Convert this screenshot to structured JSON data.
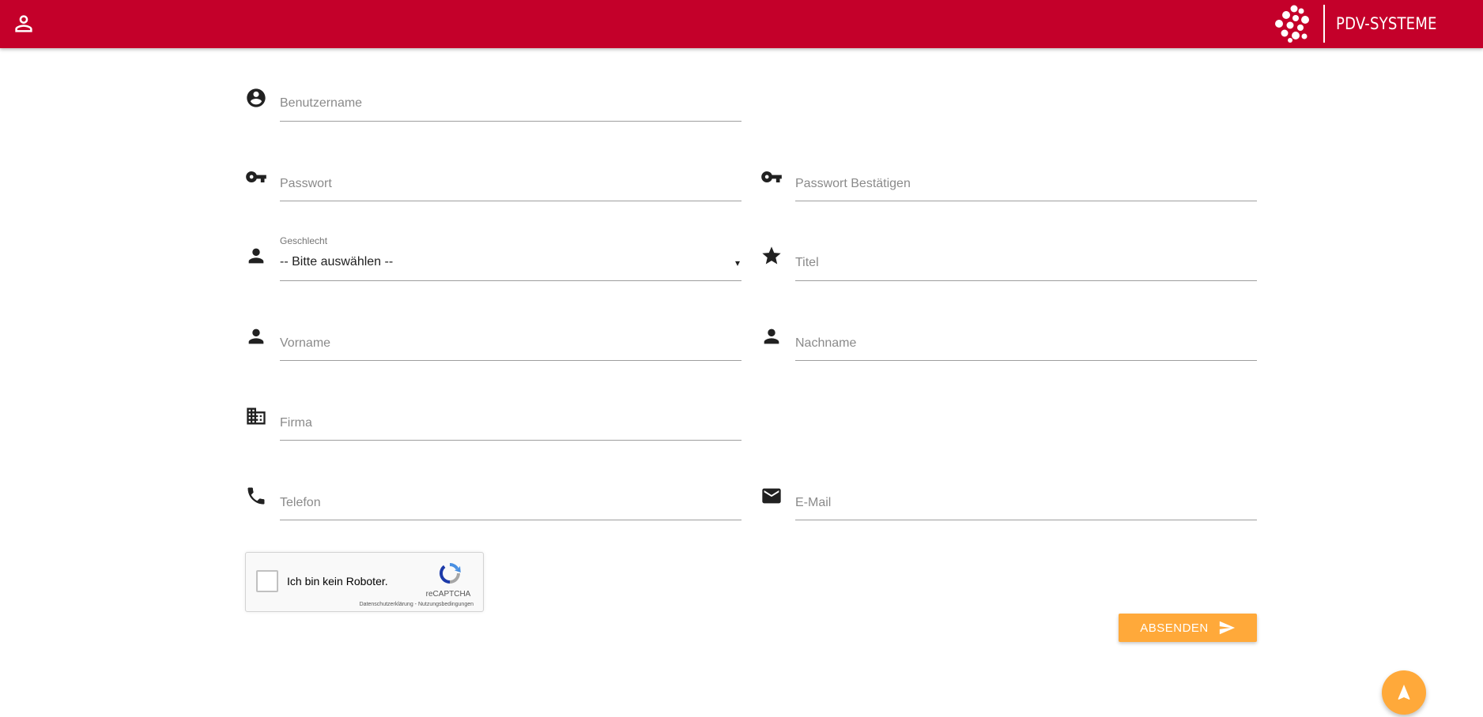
{
  "brand": {
    "name": "PDV-SYSTEME",
    "color": "#c4002a"
  },
  "header": {
    "user_icon": "person-outline-icon"
  },
  "form": {
    "username": {
      "placeholder": "Benutzername",
      "icon": "account-circle-icon"
    },
    "password": {
      "placeholder": "Passwort",
      "icon": "key-icon"
    },
    "password_confirm": {
      "placeholder": "Passwort Bestätigen",
      "icon": "key-icon"
    },
    "gender": {
      "label": "Geschlecht",
      "value": "-- Bitte auswählen --",
      "arrow": "▾",
      "icon": "person-icon"
    },
    "title": {
      "placeholder": "Titel",
      "icon": "star-icon"
    },
    "firstname": {
      "placeholder": "Vorname",
      "icon": "person-icon"
    },
    "lastname": {
      "placeholder": "Nachname",
      "icon": "person-icon"
    },
    "company": {
      "placeholder": "Firma",
      "icon": "building-icon"
    },
    "phone": {
      "placeholder": "Telefon",
      "icon": "phone-icon"
    },
    "email": {
      "placeholder": "E-Mail",
      "icon": "mail-icon"
    }
  },
  "recaptcha": {
    "label": "Ich bin kein Roboter.",
    "brand": "reCAPTCHA",
    "links": "Datenschutzerklärung - Nutzungsbedingungen"
  },
  "submit": {
    "label": "ABSENDEN",
    "icon": "send-icon",
    "color": "#ffa93a"
  },
  "fab": {
    "icon": "navigation-icon",
    "color": "#ffa93a"
  }
}
